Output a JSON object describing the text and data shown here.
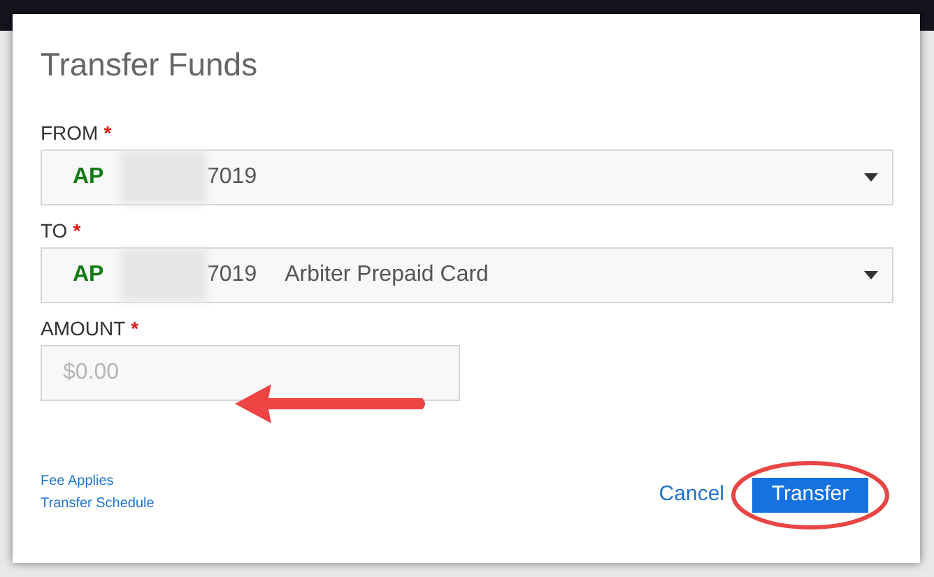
{
  "dialog": {
    "title": "Transfer Funds",
    "fields": [
      {
        "kind": "select",
        "label": "FROM",
        "required_mark": "*",
        "badge": "AP",
        "account": "7019"
      },
      {
        "kind": "select",
        "label": "TO",
        "required_mark": "*",
        "badge": "AP",
        "account": "7019",
        "name": "Arbiter Prepaid Card"
      },
      {
        "kind": "input",
        "label": "AMOUNT",
        "required_mark": "*",
        "placeholder": "$0.00"
      }
    ],
    "links": [
      "Fee Applies",
      "Transfer Schedule"
    ],
    "buttons": [
      {
        "label": "Cancel",
        "kind": "link"
      },
      {
        "label": "Transfer",
        "kind": "primary"
      }
    ]
  }
}
